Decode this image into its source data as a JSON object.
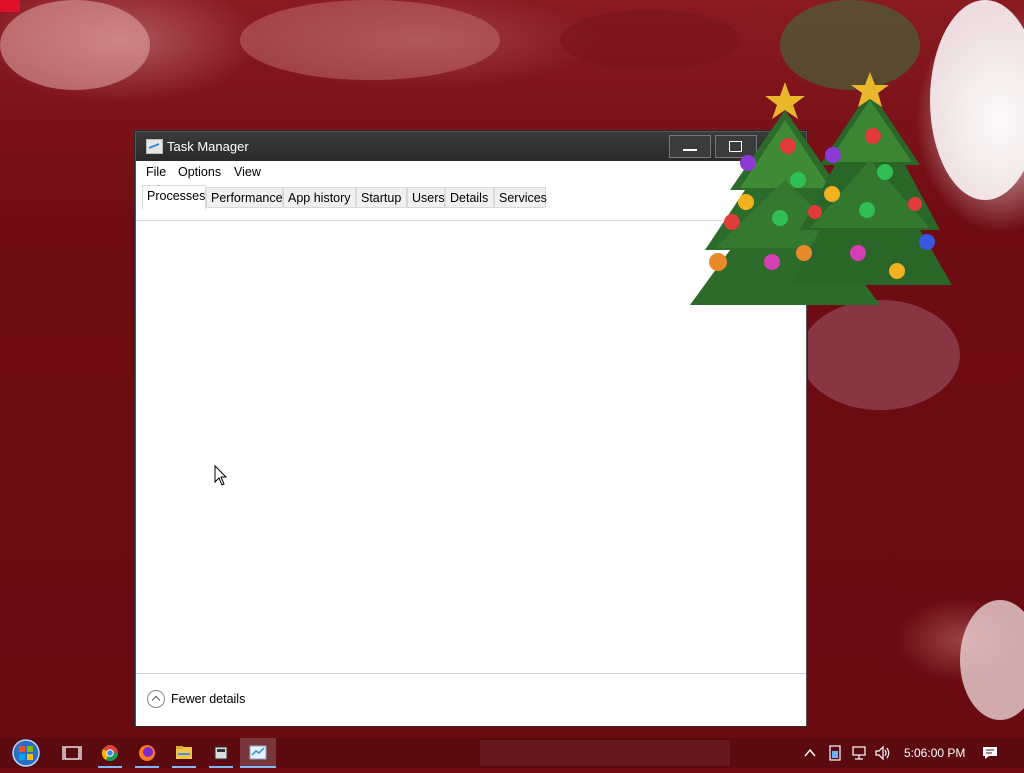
{
  "window": {
    "title": "Task Manager",
    "menu": [
      "File",
      "Options",
      "View"
    ],
    "tabs": [
      "Processes",
      "Performance",
      "App history",
      "Startup",
      "Users",
      "Details",
      "Services"
    ],
    "active_tab": "Processes",
    "footer_label": "Fewer details"
  },
  "taskbar": {
    "items": [
      {
        "name": "start-button",
        "icon": "windows-start-icon"
      },
      {
        "name": "task-view",
        "icon": "task-view-icon"
      },
      {
        "name": "chrome",
        "icon": "chrome-icon"
      },
      {
        "name": "firefox",
        "icon": "firefox-icon"
      },
      {
        "name": "file-explorer",
        "icon": "folder-icon"
      },
      {
        "name": "app",
        "icon": "app-icon"
      },
      {
        "name": "task-manager",
        "icon": "task-manager-icon"
      }
    ],
    "clock": "5:06:00 PM"
  },
  "colors": {
    "wallpaper": "#6e0b12",
    "titlebar": "#2b2b2b",
    "taskbar": "#5b0a10",
    "accent": "#7fb8ff"
  }
}
